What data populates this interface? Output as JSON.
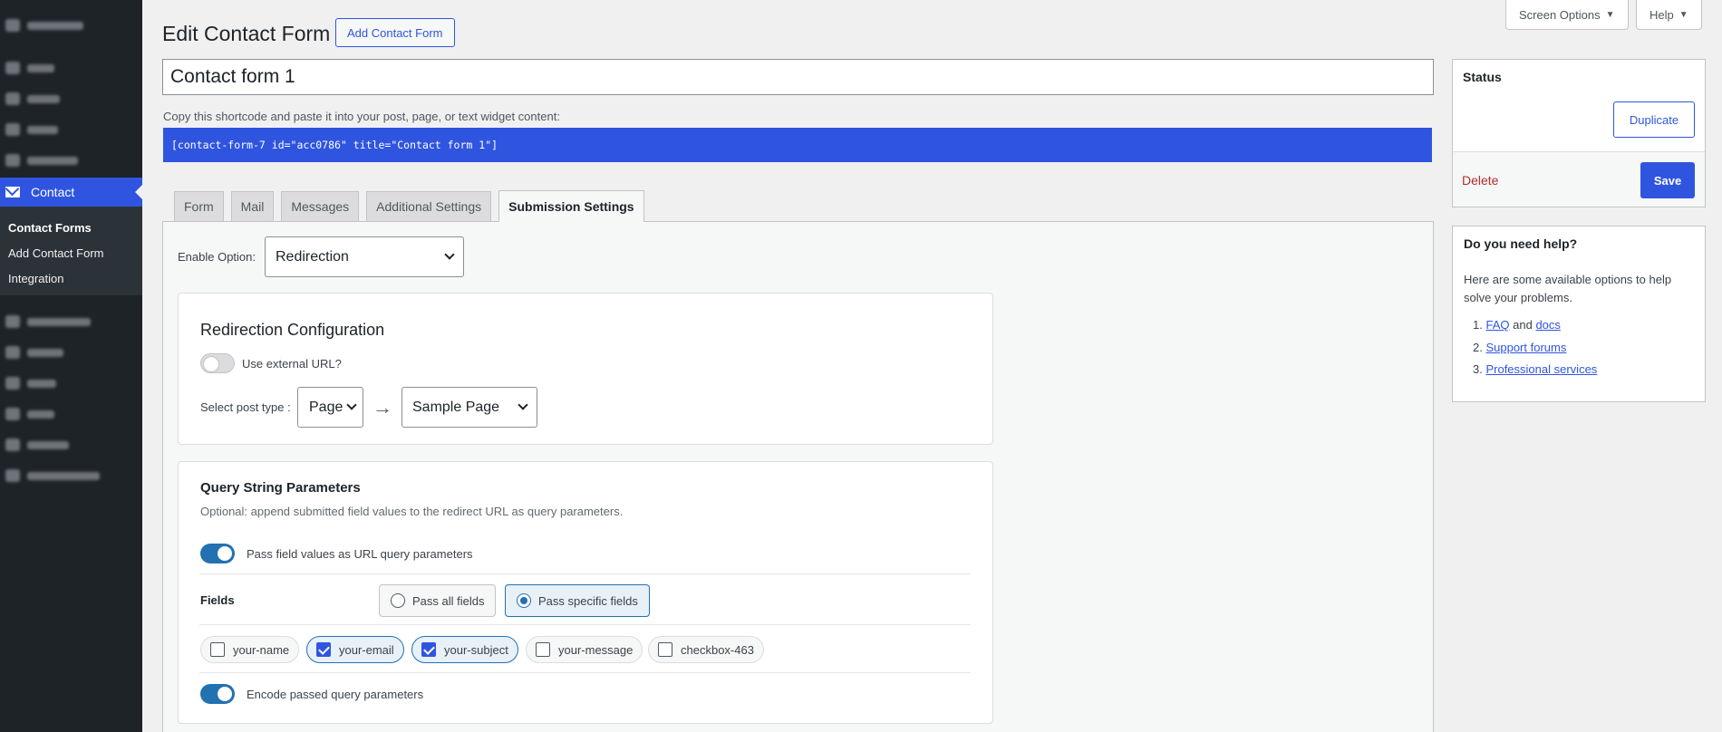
{
  "sidebar": {
    "active_label": "Contact",
    "submenu": [
      "Contact Forms",
      "Add Contact Form",
      "Integration"
    ]
  },
  "topbar": {
    "screen_options": "Screen Options",
    "help": "Help"
  },
  "header": {
    "title": "Edit Contact Form",
    "add_button": "Add Contact Form"
  },
  "form": {
    "title_value": "Contact form 1",
    "shortcode_note": "Copy this shortcode and paste it into your post, page, or text widget content:",
    "shortcode": "[contact-form-7 id=\"acc0786\" title=\"Contact form 1\"]"
  },
  "tabs": [
    "Form",
    "Mail",
    "Messages",
    "Additional Settings",
    "Submission Settings"
  ],
  "submission": {
    "enable_label": "Enable Option:",
    "enable_value": "Redirection",
    "redirect": {
      "title": "Redirection Configuration",
      "external_label": "Use external URL?",
      "post_type_label": "Select post type :",
      "post_type_value": "Page",
      "arrow": "→",
      "page_value": "Sample Page"
    },
    "query": {
      "title": "Query String Parameters",
      "description": "Optional: append submitted field values to the redirect URL as query parameters.",
      "pass_label": "Pass field values as URL query parameters",
      "fields_label": "Fields",
      "pass_all": "Pass all fields",
      "pass_specific": "Pass specific fields",
      "field_chips": [
        {
          "label": "your-name",
          "checked": false
        },
        {
          "label": "your-email",
          "checked": true
        },
        {
          "label": "your-subject",
          "checked": true
        },
        {
          "label": "your-message",
          "checked": false
        },
        {
          "label": "checkbox-463",
          "checked": false
        }
      ],
      "encode_label": "Encode passed query parameters"
    }
  },
  "status_box": {
    "title": "Status",
    "duplicate": "Duplicate",
    "delete": "Delete",
    "save": "Save"
  },
  "help_box": {
    "title": "Do you need help?",
    "text": "Here are some available options to help solve your problems.",
    "items": {
      "faq": "FAQ",
      "and": "and",
      "docs": "docs",
      "forums": "Support forums",
      "services": "Professional services"
    }
  },
  "colors": {
    "accent": "#2f55e0",
    "sidebar_bg": "#1d2327",
    "toggle_on": "#2271b1",
    "delete": "#b32d2e"
  }
}
